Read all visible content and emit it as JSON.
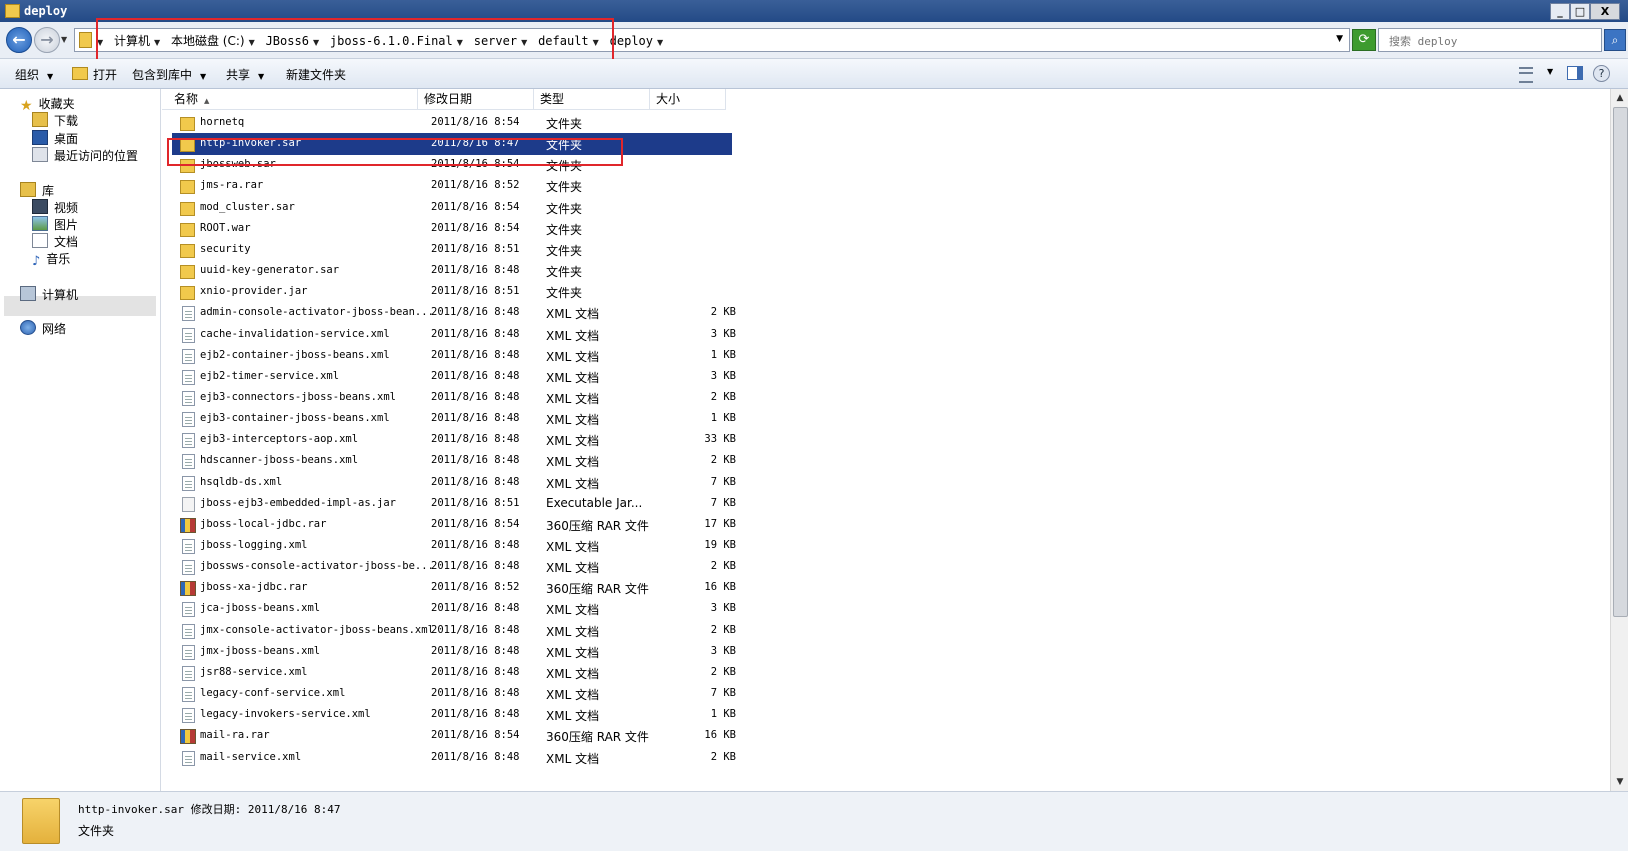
{
  "window": {
    "title": "deploy"
  },
  "window_buttons": {
    "minimize": "_",
    "maximize": "□",
    "close": "X"
  },
  "address": {
    "crumbs": [
      "计算机",
      "本地磁盘 (C:)",
      "JBoss6",
      "jboss-6.1.0.Final",
      "server",
      "default",
      "deploy"
    ],
    "search_placeholder": "搜索 deploy"
  },
  "toolbar": {
    "organize": "组织",
    "open": "打开",
    "include_library": "包含到库中",
    "share": "共享",
    "new_folder": "新建文件夹"
  },
  "nav": {
    "favorites": "收藏夹",
    "downloads": "下载",
    "desktop": "桌面",
    "recent": "最近访问的位置",
    "libraries": "库",
    "videos": "视频",
    "pictures": "图片",
    "documents": "文档",
    "music": "音乐",
    "computer": "计算机",
    "network": "网络"
  },
  "columns": {
    "name": "名称",
    "date": "修改日期",
    "type": "类型",
    "size": "大小"
  },
  "files": [
    {
      "name": "hornetq",
      "date": "2011/8/16 8:54",
      "type": "文件夹",
      "size": "",
      "icon": "folder"
    },
    {
      "name": "http-invoker.sar",
      "date": "2011/8/16 8:47",
      "type": "文件夹",
      "size": "",
      "icon": "folder",
      "selected": true
    },
    {
      "name": "jbossweb.sar",
      "date": "2011/8/16 8:54",
      "type": "文件夹",
      "size": "",
      "icon": "folder"
    },
    {
      "name": "jms-ra.rar",
      "date": "2011/8/16 8:52",
      "type": "文件夹",
      "size": "",
      "icon": "folder"
    },
    {
      "name": "mod_cluster.sar",
      "date": "2011/8/16 8:54",
      "type": "文件夹",
      "size": "",
      "icon": "folder"
    },
    {
      "name": "ROOT.war",
      "date": "2011/8/16 8:54",
      "type": "文件夹",
      "size": "",
      "icon": "folder"
    },
    {
      "name": "security",
      "date": "2011/8/16 8:51",
      "type": "文件夹",
      "size": "",
      "icon": "folder"
    },
    {
      "name": "uuid-key-generator.sar",
      "date": "2011/8/16 8:48",
      "type": "文件夹",
      "size": "",
      "icon": "folder"
    },
    {
      "name": "xnio-provider.jar",
      "date": "2011/8/16 8:51",
      "type": "文件夹",
      "size": "",
      "icon": "folder"
    },
    {
      "name": "admin-console-activator-jboss-bean...",
      "date": "2011/8/16 8:48",
      "type": "XML 文档",
      "size": "2 KB",
      "icon": "doc"
    },
    {
      "name": "cache-invalidation-service.xml",
      "date": "2011/8/16 8:48",
      "type": "XML 文档",
      "size": "3 KB",
      "icon": "doc"
    },
    {
      "name": "ejb2-container-jboss-beans.xml",
      "date": "2011/8/16 8:48",
      "type": "XML 文档",
      "size": "1 KB",
      "icon": "doc"
    },
    {
      "name": "ejb2-timer-service.xml",
      "date": "2011/8/16 8:48",
      "type": "XML 文档",
      "size": "3 KB",
      "icon": "doc"
    },
    {
      "name": "ejb3-connectors-jboss-beans.xml",
      "date": "2011/8/16 8:48",
      "type": "XML 文档",
      "size": "2 KB",
      "icon": "doc"
    },
    {
      "name": "ejb3-container-jboss-beans.xml",
      "date": "2011/8/16 8:48",
      "type": "XML 文档",
      "size": "1 KB",
      "icon": "doc"
    },
    {
      "name": "ejb3-interceptors-aop.xml",
      "date": "2011/8/16 8:48",
      "type": "XML 文档",
      "size": "33 KB",
      "icon": "doc"
    },
    {
      "name": "hdscanner-jboss-beans.xml",
      "date": "2011/8/16 8:48",
      "type": "XML 文档",
      "size": "2 KB",
      "icon": "doc"
    },
    {
      "name": "hsqldb-ds.xml",
      "date": "2011/8/16 8:48",
      "type": "XML 文档",
      "size": "7 KB",
      "icon": "doc"
    },
    {
      "name": "jboss-ejb3-embedded-impl-as.jar",
      "date": "2011/8/16 8:51",
      "type": "Executable Jar...",
      "size": "7 KB",
      "icon": "exe"
    },
    {
      "name": "jboss-local-jdbc.rar",
      "date": "2011/8/16 8:54",
      "type": "360压缩 RAR 文件",
      "size": "17 KB",
      "icon": "rar"
    },
    {
      "name": "jboss-logging.xml",
      "date": "2011/8/16 8:48",
      "type": "XML 文档",
      "size": "19 KB",
      "icon": "doc"
    },
    {
      "name": "jbossws-console-activator-jboss-be...",
      "date": "2011/8/16 8:48",
      "type": "XML 文档",
      "size": "2 KB",
      "icon": "doc"
    },
    {
      "name": "jboss-xa-jdbc.rar",
      "date": "2011/8/16 8:52",
      "type": "360压缩 RAR 文件",
      "size": "16 KB",
      "icon": "rar"
    },
    {
      "name": "jca-jboss-beans.xml",
      "date": "2011/8/16 8:48",
      "type": "XML 文档",
      "size": "3 KB",
      "icon": "doc"
    },
    {
      "name": "jmx-console-activator-jboss-beans.xml",
      "date": "2011/8/16 8:48",
      "type": "XML 文档",
      "size": "2 KB",
      "icon": "doc"
    },
    {
      "name": "jmx-jboss-beans.xml",
      "date": "2011/8/16 8:48",
      "type": "XML 文档",
      "size": "3 KB",
      "icon": "doc"
    },
    {
      "name": "jsr88-service.xml",
      "date": "2011/8/16 8:48",
      "type": "XML 文档",
      "size": "2 KB",
      "icon": "doc"
    },
    {
      "name": "legacy-conf-service.xml",
      "date": "2011/8/16 8:48",
      "type": "XML 文档",
      "size": "7 KB",
      "icon": "doc"
    },
    {
      "name": "legacy-invokers-service.xml",
      "date": "2011/8/16 8:48",
      "type": "XML 文档",
      "size": "1 KB",
      "icon": "doc"
    },
    {
      "name": "mail-ra.rar",
      "date": "2011/8/16 8:54",
      "type": "360压缩 RAR 文件",
      "size": "16 KB",
      "icon": "rar"
    },
    {
      "name": "mail-service.xml",
      "date": "2011/8/16 8:48",
      "type": "XML 文档",
      "size": "2 KB",
      "icon": "doc"
    }
  ],
  "details": {
    "line1": "http-invoker.sar  修改日期: 2011/8/16 8:47",
    "line2": "文件夹"
  },
  "colors": {
    "selection": "#1d3b8a",
    "highlight_box": "#e0262b",
    "titlebar": "#2d5590"
  }
}
